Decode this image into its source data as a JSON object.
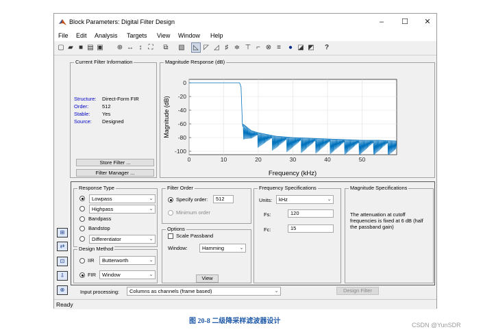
{
  "window": {
    "title": "Block Parameters: Digital Filter Design",
    "minimize": "–",
    "maximize": "☐",
    "close": "✕"
  },
  "menu": [
    "File",
    "Edit",
    "Analysis",
    "Targets",
    "View",
    "Window",
    "Help"
  ],
  "toolbar_icons": [
    "new-icon",
    "open-icon",
    "save-icon",
    "print-icon",
    "print-preview-icon",
    "zoom-in-icon",
    "zoom-x-icon",
    "zoom-y-icon",
    "full-view-icon",
    "new-figure-icon",
    "filter-specs-icon",
    "magnitude-icon",
    "phase-icon",
    "mag-phase-icon",
    "group-delay-icon",
    "phase-delay-icon",
    "impulse-icon",
    "step-icon",
    "pole-zero-icon",
    "coefficients-icon",
    "info-icon",
    "round-off-icon",
    "magnitude-estimate-icon",
    "whats-this-icon"
  ],
  "current_filter": {
    "label": "Current Filter Information",
    "rows": [
      {
        "k": "Structure:",
        "v": "Direct-Form FIR"
      },
      {
        "k": "Order:",
        "v": "512"
      },
      {
        "k": "Stable:",
        "v": "Yes"
      },
      {
        "k": "Source:",
        "v": "Designed"
      }
    ],
    "store_button": "Store Filter ...",
    "manager_button": "Filter Manager ..."
  },
  "plot": {
    "label": "Magnitude Response (dB)",
    "line_color": "#0072bd"
  },
  "chart_data": {
    "type": "line",
    "xlabel": "Frequency (kHz)",
    "ylabel": "Magnitude (dB)",
    "xlim": [
      0,
      60
    ],
    "ylim": [
      -105,
      5
    ],
    "xticks": [
      0,
      10,
      20,
      30,
      40,
      50
    ],
    "yticks": [
      0,
      -20,
      -40,
      -60,
      -80,
      -100
    ],
    "series": [
      {
        "x": [
          0,
          14.6,
          15.0,
          15.4,
          16,
          17,
          18,
          20,
          22,
          25,
          30,
          35,
          40,
          45,
          50,
          55,
          60
        ],
        "y": [
          0,
          0,
          -6,
          -60,
          -62,
          -66,
          -70,
          -73,
          -75,
          -78,
          -80,
          -81,
          -82,
          -83,
          -84,
          -84,
          -85
        ]
      }
    ],
    "grid": true
  },
  "response_type": {
    "label": "Response Type",
    "options": [
      {
        "name": "Lowpass",
        "selected": true,
        "combo": "Lowpass"
      },
      {
        "name": "Highpass",
        "selected": false,
        "combo": "Highpass"
      },
      {
        "name": "Bandpass",
        "selected": false
      },
      {
        "name": "Bandstop",
        "selected": false
      },
      {
        "name": "Differentiator",
        "selected": false,
        "combo": "Differentiator"
      }
    ]
  },
  "design_method": {
    "label": "Design Method",
    "iir_label": "IIR",
    "iir_value": "Butterworth",
    "fir_label": "FIR",
    "fir_value": "Window"
  },
  "filter_order": {
    "label": "Filter Order",
    "specify_label": "Specify order:",
    "specify_value": "512",
    "minimum_label": "Minimum order"
  },
  "options": {
    "label": "Options",
    "scale_passband": "Scale Passband",
    "window_label": "Window:",
    "window_value": "Hamming",
    "view_button": "View"
  },
  "freq_specs": {
    "label": "Frequency Specifications",
    "units_label": "Units:",
    "units_value": "kHz",
    "fs_label": "Fs:",
    "fs_value": "120",
    "fc_label": "Fc:",
    "fc_value": "15"
  },
  "mag_specs": {
    "label": "Magnitude Specifications",
    "text": "The attenuation at cutoff frequencies is fixed at 6 dB (half the passband gain)"
  },
  "input_processing": {
    "label": "Input processing:",
    "value": "Columns as channels (frame based)"
  },
  "design_button": "Design Filter",
  "status": "Ready",
  "side_icons": [
    "design-panel-icon",
    "transform-icon",
    "realize-model-icon",
    "import-icon",
    "pole-zero-editor-icon"
  ],
  "caption": "图 20-8 二级降采样滤波器设计",
  "watermark": "CSDN @YunSDR"
}
